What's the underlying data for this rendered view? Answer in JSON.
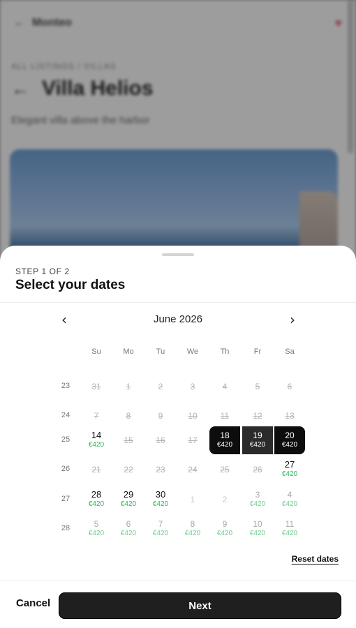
{
  "background": {
    "app_name": "Monteo",
    "breadcrumb": "ALL LISTINGS / VILLAS",
    "title": "Villa Helios",
    "subtitle": "Elegant villa above the harbor"
  },
  "sheet": {
    "step": "STEP 1 OF 2",
    "title": "Select your dates",
    "month": "June 2026",
    "weekdays": [
      "Su",
      "Mo",
      "Tu",
      "We",
      "Th",
      "Fr",
      "Sa"
    ],
    "weeks": [
      {
        "num": "23",
        "days": [
          {
            "d": "31",
            "s": "unavail"
          },
          {
            "d": "1",
            "s": "unavail"
          },
          {
            "d": "2",
            "s": "unavail"
          },
          {
            "d": "3",
            "s": "unavail"
          },
          {
            "d": "4",
            "s": "unavail"
          },
          {
            "d": "5",
            "s": "unavail"
          },
          {
            "d": "6",
            "s": "unavail"
          }
        ]
      },
      {
        "num": "24",
        "days": [
          {
            "d": "7",
            "s": "unavail"
          },
          {
            "d": "8",
            "s": "unavail"
          },
          {
            "d": "9",
            "s": "unavail"
          },
          {
            "d": "10",
            "s": "unavail"
          },
          {
            "d": "11",
            "s": "unavail"
          },
          {
            "d": "12",
            "s": "unavail"
          },
          {
            "d": "13",
            "s": "unavail"
          }
        ]
      },
      {
        "num": "25",
        "days": [
          {
            "d": "14",
            "s": "avail",
            "p": "€420"
          },
          {
            "d": "15",
            "s": "unavail"
          },
          {
            "d": "16",
            "s": "unavail"
          },
          {
            "d": "17",
            "s": "unavail"
          },
          {
            "d": "18",
            "s": "sel-start",
            "p": "€420"
          },
          {
            "d": "19",
            "s": "sel-mid",
            "p": "€420"
          },
          {
            "d": "20",
            "s": "sel-end",
            "p": "€420"
          }
        ]
      },
      {
        "num": "26",
        "days": [
          {
            "d": "21",
            "s": "unavail"
          },
          {
            "d": "22",
            "s": "unavail"
          },
          {
            "d": "23",
            "s": "unavail"
          },
          {
            "d": "24",
            "s": "unavail"
          },
          {
            "d": "25",
            "s": "unavail"
          },
          {
            "d": "26",
            "s": "unavail"
          },
          {
            "d": "27",
            "s": "avail",
            "p": "€420"
          }
        ]
      },
      {
        "num": "27",
        "days": [
          {
            "d": "28",
            "s": "avail",
            "p": "€420"
          },
          {
            "d": "29",
            "s": "avail",
            "p": "€420"
          },
          {
            "d": "30",
            "s": "avail",
            "p": "€420"
          },
          {
            "d": "1",
            "s": "faded-only"
          },
          {
            "d": "2",
            "s": "faded-only"
          },
          {
            "d": "3",
            "s": "faded",
            "p": "€420"
          },
          {
            "d": "4",
            "s": "faded",
            "p": "€420"
          }
        ]
      },
      {
        "num": "28",
        "days": [
          {
            "d": "5",
            "s": "faded",
            "p": "€420"
          },
          {
            "d": "6",
            "s": "faded",
            "p": "€420"
          },
          {
            "d": "7",
            "s": "faded",
            "p": "€420"
          },
          {
            "d": "8",
            "s": "faded",
            "p": "€420"
          },
          {
            "d": "9",
            "s": "faded",
            "p": "€420"
          },
          {
            "d": "10",
            "s": "faded",
            "p": "€420"
          },
          {
            "d": "11",
            "s": "faded",
            "p": "€420"
          }
        ]
      }
    ],
    "reset_label": "Reset dates",
    "cancel_label": "Cancel",
    "next_label": "Next",
    "prev_icon": "chevron-left-icon",
    "next_icon": "chevron-right-icon"
  },
  "colors": {
    "selected": "#0d0d0d",
    "price": "#2fb35e",
    "primary_button": "#1f1f1f"
  }
}
